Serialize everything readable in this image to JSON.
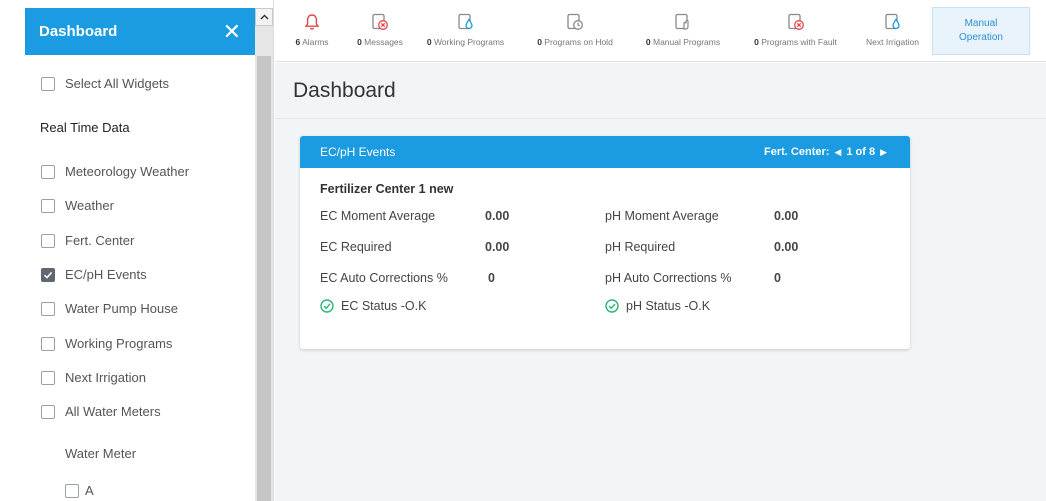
{
  "sidebar": {
    "title": "Dashboard",
    "close_icon": "close-icon",
    "select_all": "Select All Widgets",
    "section_heading": "Real Time Data",
    "items": [
      {
        "label": "Meteorology Weather",
        "checked": false
      },
      {
        "label": "Weather",
        "checked": false
      },
      {
        "label": "Fert. Center",
        "checked": false
      },
      {
        "label": "EC/pH Events",
        "checked": true
      },
      {
        "label": "Water Pump House",
        "checked": false
      },
      {
        "label": "Working Programs",
        "checked": false
      },
      {
        "label": "Next Irrigation",
        "checked": false
      },
      {
        "label": "All Water Meters",
        "checked": false
      }
    ],
    "water_meter_heading": "Water Meter",
    "water_meter_items": [
      {
        "label": "A",
        "checked": false
      }
    ]
  },
  "topbar": {
    "items": [
      {
        "count": "6",
        "label": "Alarms",
        "icon": "bell-icon",
        "color": "#e2464c"
      },
      {
        "count": "0",
        "label": "Messages",
        "icon": "message-error-icon",
        "color": "#e2464c"
      },
      {
        "count": "0",
        "label": "Working Programs",
        "icon": "program-drop-icon",
        "color": "#1a9be2"
      },
      {
        "count": "0",
        "label": "Programs on Hold",
        "icon": "program-clock-icon",
        "color": "#888888"
      },
      {
        "count": "0",
        "label": "Manual Programs",
        "icon": "program-hand-icon",
        "color": "#888888"
      },
      {
        "count": "0",
        "label": "Programs with Fault",
        "icon": "program-fault-icon",
        "color": "#e2464c"
      },
      {
        "count": "",
        "label": "Next Irrigation",
        "icon": "next-irrigation-icon",
        "color": "#1a9be2"
      }
    ],
    "manual_operation_line1": "Manual",
    "manual_operation_line2": "Operation"
  },
  "main": {
    "title": "Dashboard",
    "card": {
      "title": "EC/pH Events",
      "nav_label": "Fert. Center:",
      "nav_position": "1 of 8",
      "center_name": "Fertilizer Center 1 new",
      "rows": [
        {
          "left_label": "EC Moment Average",
          "left_value": "0.00",
          "right_label": "pH Moment Average",
          "right_value": "0.00"
        },
        {
          "left_label": "EC Required",
          "left_value": "0.00",
          "right_label": "pH Required",
          "right_value": "0.00"
        },
        {
          "left_label": "EC Auto Corrections %",
          "left_value": "0",
          "right_label": "pH Auto Corrections %",
          "right_value": "0"
        }
      ],
      "ec_status": "EC Status -O.K",
      "ph_status": "pH Status -O.K",
      "status_color": "#2bb673"
    }
  },
  "colors": {
    "accent": "#1a9be2",
    "alert": "#e2464c",
    "ok": "#2bb673"
  }
}
